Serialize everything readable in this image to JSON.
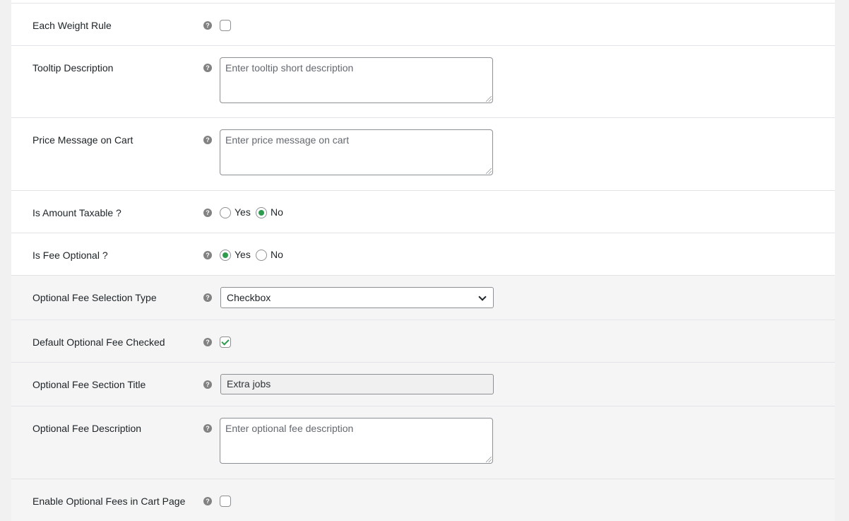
{
  "form": {
    "each_weight_rule": {
      "label": "Each Weight Rule",
      "checked": false
    },
    "tooltip_description": {
      "label": "Tooltip Description",
      "placeholder": "Enter tooltip short description"
    },
    "price_message_on_cart": {
      "label": "Price Message on Cart",
      "placeholder": "Enter price message on cart"
    },
    "is_amount_taxable": {
      "label": "Is Amount Taxable ?",
      "options": [
        "Yes",
        "No"
      ],
      "selected": "No"
    },
    "is_fee_optional": {
      "label": "Is Fee Optional ?",
      "options": [
        "Yes",
        "No"
      ],
      "selected": "Yes"
    },
    "optional_fee_selection_type": {
      "label": "Optional Fee Selection Type",
      "selected": "Checkbox"
    },
    "default_optional_fee_checked": {
      "label": "Default Optional Fee Checked",
      "checked": true
    },
    "optional_fee_section_title": {
      "label": "Optional Fee Section Title",
      "value": "Extra jobs"
    },
    "optional_fee_description": {
      "label": "Optional Fee Description",
      "placeholder": "Enter optional fee description"
    },
    "enable_optional_fees_in_cart_page": {
      "label": "Enable Optional Fees in Cart Page",
      "checked": false
    }
  },
  "icons": {
    "help": "question-circle-icon",
    "dropdown": "chevron-down-icon"
  },
  "colors": {
    "accent": "#2e9b4f",
    "help_icon": "#828282",
    "row_alt_background": "#f5f5f5"
  }
}
